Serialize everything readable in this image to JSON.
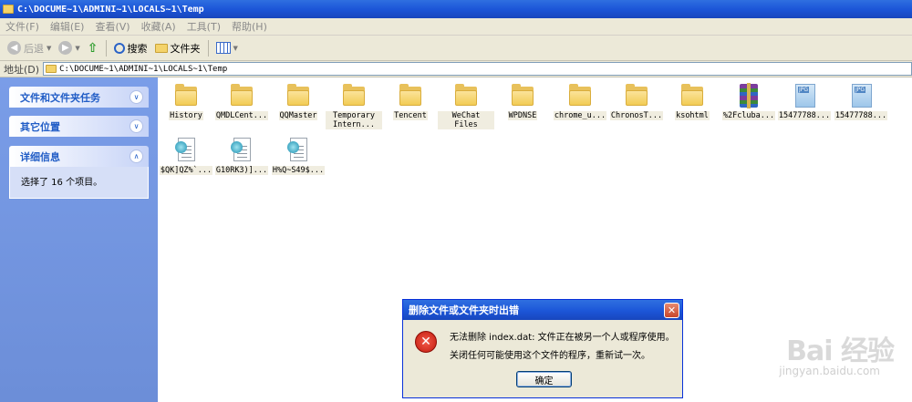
{
  "window": {
    "title": "C:\\DOCUME~1\\ADMINI~1\\LOCALS~1\\Temp"
  },
  "menu": [
    "文件(F)",
    "编辑(E)",
    "查看(V)",
    "收藏(A)",
    "工具(T)",
    "帮助(H)"
  ],
  "toolbar": {
    "back": "后退",
    "search": "搜索",
    "folders": "文件夹"
  },
  "address": {
    "label": "地址(D)",
    "path": "C:\\DOCUME~1\\ADMINI~1\\LOCALS~1\\Temp"
  },
  "sidebar": {
    "tasks_title": "文件和文件夹任务",
    "other_title": "其它位置",
    "details_title": "详细信息",
    "details_text": "选择了 16 个项目。"
  },
  "files": [
    {
      "name": "History",
      "type": "folder"
    },
    {
      "name": "QMDLCent...",
      "type": "folder"
    },
    {
      "name": "QQMaster",
      "type": "folder"
    },
    {
      "name": "Temporary Intern...",
      "type": "folder"
    },
    {
      "name": "Tencent",
      "type": "folder"
    },
    {
      "name": "WeChat Files",
      "type": "folder"
    },
    {
      "name": "WPDNSE",
      "type": "folder"
    },
    {
      "name": "chrome_u...",
      "type": "folder"
    },
    {
      "name": "ChronosT...",
      "type": "folder"
    },
    {
      "name": "ksohtml",
      "type": "folder"
    },
    {
      "name": "%2Fcluba...",
      "type": "rar"
    },
    {
      "name": "15477788...",
      "type": "jpg"
    },
    {
      "name": "15477788...",
      "type": "jpg"
    },
    {
      "name": "$QK]QZ%`...",
      "type": "doc"
    },
    {
      "name": "G10RK3)]...",
      "type": "doc"
    },
    {
      "name": "H%Q~S49$...",
      "type": "doc"
    }
  ],
  "dialog": {
    "title": "删除文件或文件夹时出错",
    "message1": "无法删除 index.dat: 文件正在被另一个人或程序使用。",
    "message2": "关闭任何可能使用这个文件的程序，重新试一次。",
    "ok": "确定"
  },
  "watermark": {
    "brand": "Bai 经验",
    "url": "jingyan.baidu.com"
  }
}
